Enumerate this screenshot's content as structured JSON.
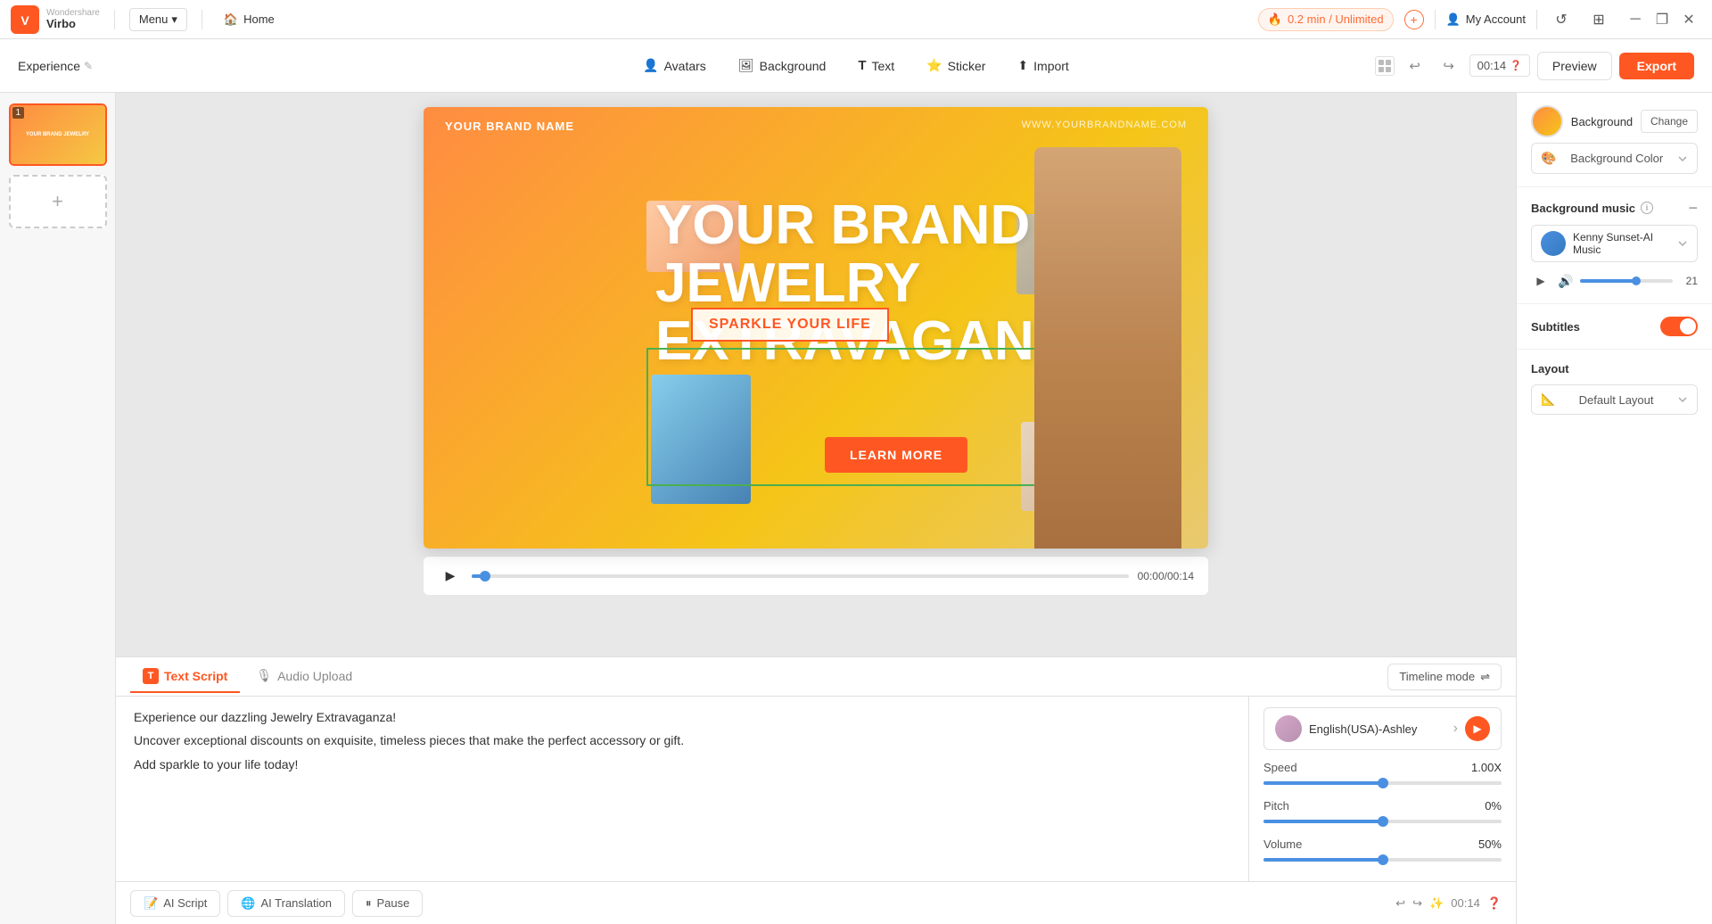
{
  "topbar": {
    "app_name": "Virbo",
    "menu_label": "Menu",
    "home_label": "Home",
    "credit": "0.2 min / Unlimited",
    "account_label": "My Account"
  },
  "toolbar": {
    "experience_label": "Experience",
    "tools": [
      {
        "id": "avatars",
        "label": "Avatars",
        "icon": "👤"
      },
      {
        "id": "background",
        "label": "Background",
        "icon": "🖼"
      },
      {
        "id": "text",
        "label": "Text",
        "icon": "T"
      },
      {
        "id": "sticker",
        "label": "Sticker",
        "icon": "⭐"
      },
      {
        "id": "import",
        "label": "Import",
        "icon": "⬆"
      }
    ],
    "time_display": "00:14",
    "preview_label": "Preview",
    "export_label": "Export"
  },
  "canvas": {
    "brand_name": "YOUR BRAND NAME",
    "website": "WWW.YOURBRANDNAME.COM",
    "main_text_line1": "YOUR BRAND",
    "main_text_line2": "JEWELRY",
    "main_text_line3": "EXTRAVAGANZA",
    "subtitle": "SPARKLE YOUR LIFE",
    "cta": "LEARN MORE"
  },
  "timeline": {
    "time_current": "00:00",
    "time_total": "00:14"
  },
  "bottom": {
    "tab_text_script": "Text Script",
    "tab_audio_upload": "Audio Upload",
    "timeline_mode": "Timeline mode",
    "script_lines": [
      "Experience our dazzling Jewelry Extravaganza!",
      "Uncover exceptional discounts on exquisite, timeless pieces that make the perfect accessory or gift.",
      "Add sparkle to your life today!"
    ],
    "voice_name": "English(USA)-Ashley",
    "speed_label": "Speed",
    "speed_value": "1.00X",
    "pitch_label": "Pitch",
    "pitch_value": "0%",
    "volume_label": "Volume",
    "volume_value": "50%",
    "btn_ai_script": "AI Script",
    "btn_ai_translation": "AI Translation",
    "btn_pause": "Pause",
    "time_bottom": "00:14"
  },
  "right_panel": {
    "background_title": "Background",
    "change_btn": "Change",
    "background_color_label": "Background Color",
    "background_music_label": "Background music",
    "music_name": "Kenny Sunset-AI Music",
    "volume_number": "21",
    "subtitles_label": "Subtitles",
    "layout_label": "Layout",
    "default_layout": "Default Layout"
  }
}
